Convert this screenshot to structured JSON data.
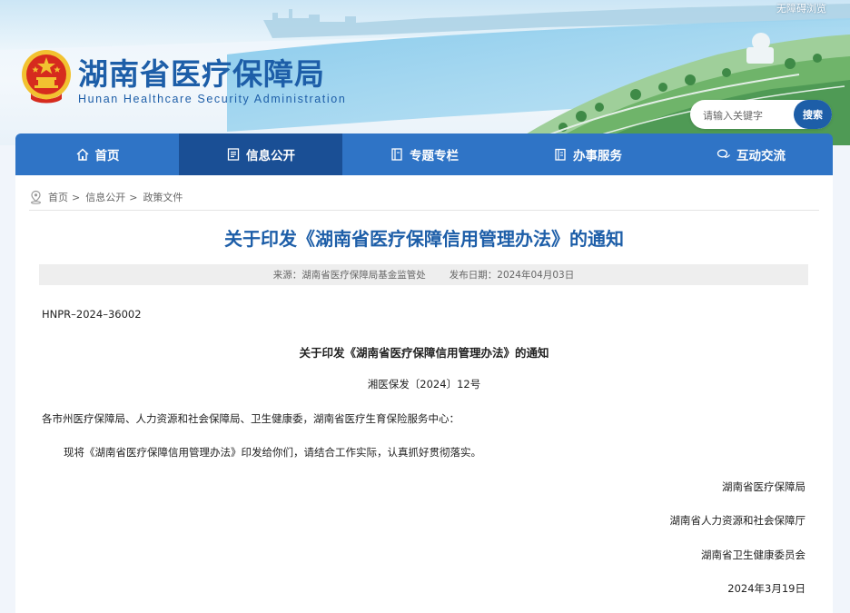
{
  "header": {
    "accessibility_link": "无障碍浏览",
    "title_cn": "湖南省医疗保障局",
    "title_en": "Hunan Healthcare Security Administration",
    "search": {
      "placeholder": "请输入关键字",
      "button_label": "搜索"
    }
  },
  "nav": {
    "items": [
      {
        "label": "首页",
        "icon": "home-icon",
        "active": false
      },
      {
        "label": "信息公开",
        "icon": "document-list-icon",
        "active": true
      },
      {
        "label": "专题专栏",
        "icon": "book-icon",
        "active": false
      },
      {
        "label": "办事服务",
        "icon": "clipboard-icon",
        "active": false
      },
      {
        "label": "互动交流",
        "icon": "chat-bubbles-icon",
        "active": false
      }
    ]
  },
  "breadcrumb": {
    "items": [
      "首页",
      "信息公开",
      "政策文件"
    ],
    "separator": ">"
  },
  "article": {
    "title": "关于印发《湖南省医疗保障信用管理办法》的通知",
    "source": "来源：湖南省医疗保障局基金监管处",
    "publish_date": "发布日期：2024年04月03日",
    "doc_number": "HNPR–2024–36002",
    "doc_title": "关于印发《湖南省医疗保障信用管理办法》的通知",
    "issue_number": "湘医保发〔2024〕12号",
    "recipients": "各市州医疗保障局、人力资源和社会保障局、卫生健康委，湖南省医疗生育保险服务中心：",
    "body": "现将《湖南省医疗保障信用管理办法》印发给你们，请结合工作实际，认真抓好贯彻落实。",
    "signatories": [
      "湖南省医疗保障局",
      "湖南省人力资源和社会保障厅",
      "湖南省卫生健康委员会"
    ],
    "sign_date": "2024年3月19日"
  },
  "colors": {
    "brand_blue": "#1d5ea8",
    "nav_blue": "#2f74c6",
    "nav_active": "#1a4f95",
    "emblem_red": "#d62b1e",
    "emblem_gold": "#f2c230"
  }
}
